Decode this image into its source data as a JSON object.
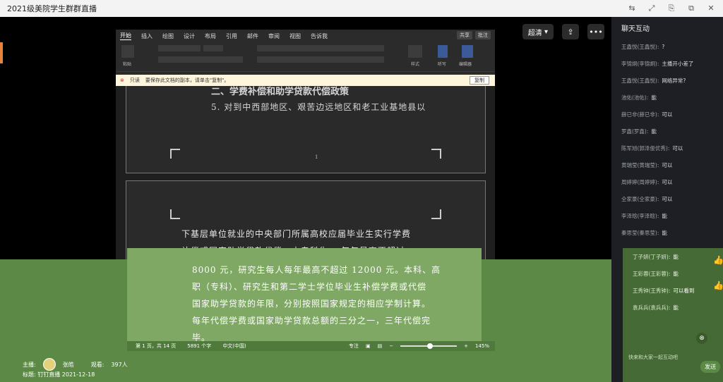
{
  "window": {
    "title": "2021级美院学生群群直播",
    "controls": [
      "⇆",
      "⤢",
      "⎘",
      "⧉",
      "✕"
    ]
  },
  "video_toolbar": {
    "quality": "超清",
    "more": "•••"
  },
  "word": {
    "tabs": [
      "开始",
      "插入",
      "绘图",
      "设计",
      "布局",
      "引用",
      "邮件",
      "审阅",
      "视图",
      "告诉我"
    ],
    "share": [
      "共享",
      "批注"
    ],
    "ribbon_labels": [
      "粘贴",
      "样式",
      "听写",
      "编辑器"
    ],
    "infobar": {
      "mode": "只读",
      "message": "要保存此文档的副本，请单击\"复制\"。",
      "copy_button": "复制"
    },
    "page1": {
      "heading": "二、学费补偿和助学贷款代偿政策",
      "line": "5. 对到中西部地区、艰苦边远地区和老工业基地县以",
      "page_number": "1"
    },
    "page2": {
      "line1": "下基层单位就业的中央部门所属高校应届毕业生实行学费",
      "line2": "补偿或国家助学贷款代偿，本专科生    、每年最高不超过",
      "line3": "8000 元，研究生每人每年最高不超过 12000 元。本科、高",
      "line4": "职（专科）、研究生和第二学士学位毕业生补偿学费或代偿",
      "line5": "国家助学贷款的年限，分别按照国家规定的相应学制计算。",
      "line6": "每年代偿学费或国家助学贷款总额的三分之一，三年代偿完",
      "line7": "毕。"
    },
    "status": {
      "page": "第 1 页，共 14 页",
      "words": "5891 个字",
      "language": "中文(中国)",
      "focus": "专注",
      "zoom": "145%"
    }
  },
  "host": {
    "label": "主播:",
    "name": "张皓",
    "viewers_label": "观看:",
    "viewers": "397人",
    "title_label": "标题:",
    "title": "钉钉直播 2021-12-18"
  },
  "chat": {
    "title": "聊天互动",
    "messages": [
      {
        "name": "王鑫悦(王鑫悦):",
        "msg": "?"
      },
      {
        "name": "李锦炯(李锦炯):",
        "msg": "主播开小差了"
      },
      {
        "name": "王鑫悦(王鑫悦):",
        "msg": "网络异常?"
      },
      {
        "name": "池佑(池佑):",
        "msg": "能"
      },
      {
        "name": "薛已非(薛已非):",
        "msg": "可以"
      },
      {
        "name": "罗鑫(罗鑫):",
        "msg": "能"
      },
      {
        "name": "陈军旭(郭泽俊优秀):",
        "msg": "可以"
      },
      {
        "name": "黄瑞莹(黄瑞莹):",
        "msg": "可以"
      },
      {
        "name": "周婷婷(周婷婷):",
        "msg": "可以"
      },
      {
        "name": "仝家豪(仝家豪):",
        "msg": "可以"
      },
      {
        "name": "李泽晗(李泽晗):",
        "msg": "能"
      },
      {
        "name": "秦思莹(秦思莹):",
        "msg": "能"
      }
    ],
    "lower_messages": [
      {
        "name": "丁子妍(丁子妍):",
        "msg": "能"
      },
      {
        "name": "王彩蓉(王彩蓉):",
        "msg": "能"
      },
      {
        "name": "王秀钟(王秀钟):",
        "msg": "可以看到"
      },
      {
        "name": "袁兵兵(袁兵兵):",
        "msg": "能"
      }
    ],
    "input_placeholder": "快来和大家一起互动吧",
    "send": "发送"
  }
}
